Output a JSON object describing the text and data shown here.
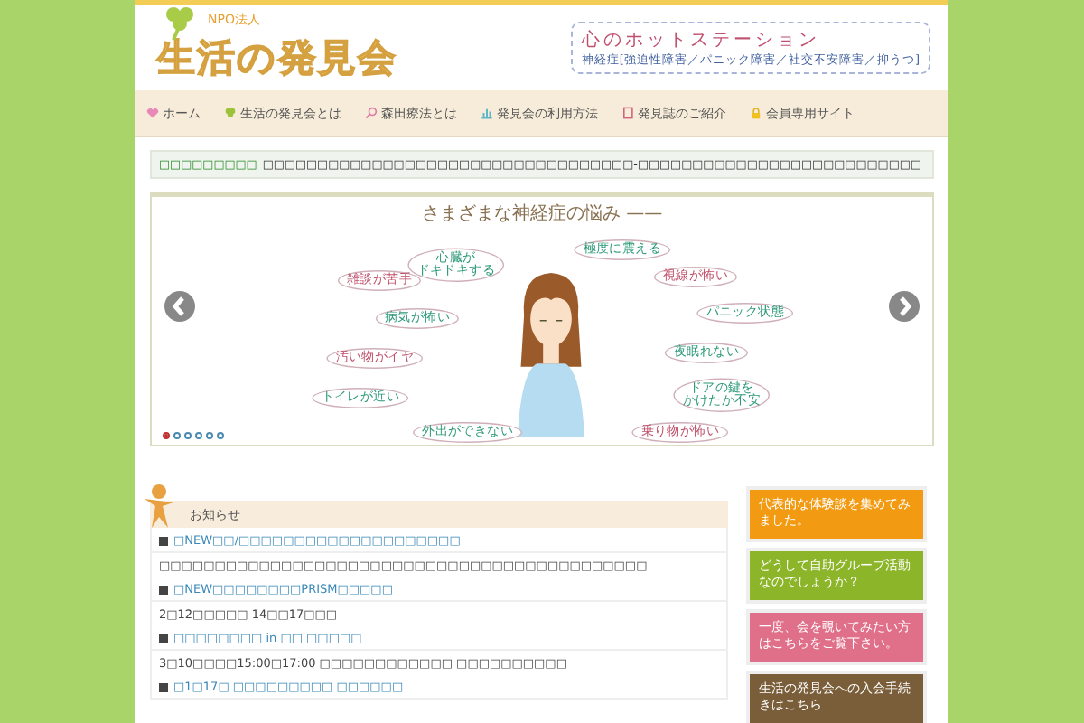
{
  "header": {
    "org_type": "NPO法人",
    "logo": "生活の発見会",
    "tagline": "心のホットステーション",
    "subtitle": "神経症[強迫性障害／パニック障害／社交不安障害／抑うつ]"
  },
  "nav": [
    {
      "label": "ホーム",
      "kind": "heart"
    },
    {
      "label": "生活の発見会とは",
      "kind": "clover"
    },
    {
      "label": "森田療法とは",
      "kind": "search"
    },
    {
      "label": "発見会の利用方法",
      "kind": "chart"
    },
    {
      "label": "発見誌のご紹介",
      "kind": "book"
    },
    {
      "label": "会員専用サイト",
      "kind": "lock"
    }
  ],
  "ticker": {
    "label": "□□□□□□□□□",
    "text": "□□□□□□□□□□□□□□□□□□□□□□□□□□□□□□□□□□-□□□□□□□□□□□□□□□□□□□□□□□□□□"
  },
  "slider": {
    "title": "さまざまな神経症の悩み ——",
    "bubbles": [
      {
        "text": "雑談が苦手",
        "color": "#c0506a"
      },
      {
        "lines": [
          "心臓が",
          "ドキドキする"
        ],
        "color": "#2e9a7a"
      },
      {
        "text": "極度に震える",
        "color": "#2e9a7a"
      },
      {
        "text": "視線が怖い",
        "color": "#c0506a"
      },
      {
        "text": "病気が怖い",
        "color": "#2e9a7a"
      },
      {
        "text": "パニック状態",
        "color": "#2e9a7a"
      },
      {
        "text": "汚い物がイヤ",
        "color": "#c0506a"
      },
      {
        "text": "夜眠れない",
        "color": "#2e9a7a"
      },
      {
        "text": "トイレが近い",
        "color": "#2e9a7a"
      },
      {
        "lines": [
          "ドアの鍵を",
          "かけたか不安"
        ],
        "color": "#2e9a7a"
      },
      {
        "text": "外出ができない",
        "color": "#2e9a7a"
      },
      {
        "text": "乗り物が怖い",
        "color": "#c0506a"
      }
    ],
    "dots": [
      {
        "selected": true
      },
      {
        "selected": false
      },
      {
        "selected": false
      },
      {
        "selected": false
      },
      {
        "selected": false
      },
      {
        "selected": false
      }
    ]
  },
  "news": {
    "title": "お知らせ",
    "items": [
      {
        "title": "□NEW□□/□□□□□□□□□□□□□□□□□□□□",
        "body": "□□□□□□□□□□□□□□□□□□□□□□□□□□□□□□□□□□□□□□□□□□□□"
      },
      {
        "title": "□NEW□□□□□□□□PRISM□□□□□",
        "body": "2□12□□□□□ 14□□17□□□"
      },
      {
        "title": "□□□□□□□□ in □□ □□□□□",
        "body": "3□10□□□□15:00□17:00 □□□□□□□□□□□□ □□□□□□□□□□"
      },
      {
        "title": "□1□17□ □□□□□□□□□ □□□□□□"
      }
    ]
  },
  "banners": [
    {
      "text": "代表的な体験談を集めてみました。",
      "color": "#f29a12"
    },
    {
      "text": "どうして自助グループ活動なのでしょうか？",
      "color": "#8cb52a"
    },
    {
      "text": "一度、会を覗いてみたい方はこちらをご覧下さい。",
      "color": "#e0708a"
    },
    {
      "text": "生活の発見会への入会手続きはこちら",
      "color": "#7a5e3a"
    }
  ]
}
